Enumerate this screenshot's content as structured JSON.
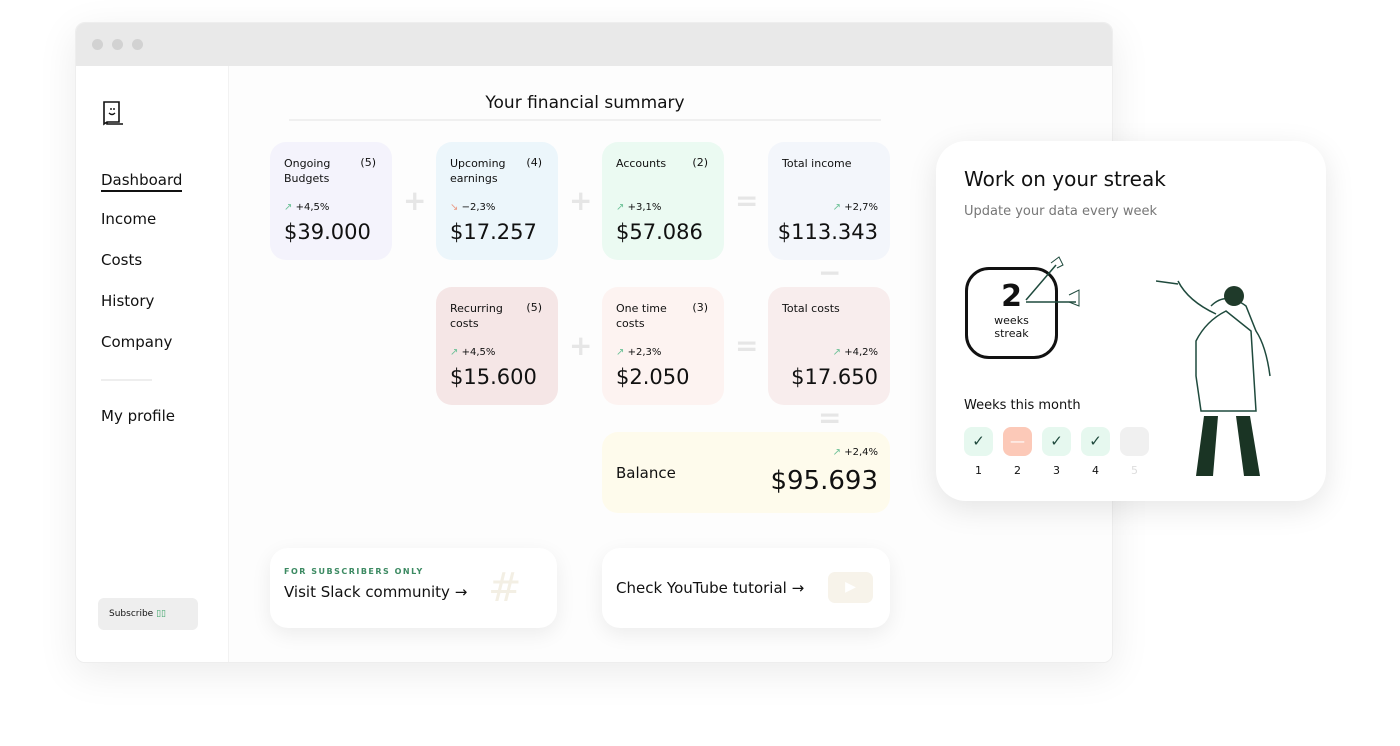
{
  "sidebar": {
    "items": [
      {
        "label": "Dashboard",
        "active": true
      },
      {
        "label": "Income"
      },
      {
        "label": "Costs"
      },
      {
        "label": "History"
      },
      {
        "label": "Company"
      }
    ],
    "profile": "My profile",
    "subscribe": "Subscribe"
  },
  "main": {
    "title": "Your financial summary",
    "cards": [
      {
        "title": "Ongoing Budgets",
        "count": "(5)",
        "change": "+4,5%",
        "trend": "up",
        "value": "$39.000",
        "color": "#f4f3fc"
      },
      {
        "title": "Upcoming earnings",
        "count": "(4)",
        "change": "−2,3%",
        "trend": "down",
        "value": "$17.257",
        "color": "#ecf6fb"
      },
      {
        "title": "Accounts",
        "count": "(2)",
        "change": "+3,1%",
        "trend": "up",
        "value": "$57.086",
        "color": "#ebfaf2"
      },
      {
        "title": "Total income",
        "count": "",
        "change": "+2,7%",
        "trend": "up",
        "value": "$113.343",
        "color": "#f3f6fb"
      },
      {
        "title": "Recurring costs",
        "count": "(5)",
        "change": "+4,5%",
        "trend": "up",
        "value": "$15.600",
        "color": "#f5e6e6"
      },
      {
        "title": "One time costs",
        "count": "(3)",
        "change": "+2,3%",
        "trend": "up",
        "value": "$2.050",
        "color": "#fdf3f1"
      },
      {
        "title": "Total costs",
        "count": "",
        "change": "+4,2%",
        "trend": "up",
        "value": "$17.650",
        "color": "#f8eded"
      }
    ],
    "balance": {
      "label": "Balance",
      "change": "+2,4%",
      "value": "$95.693"
    },
    "slack": {
      "kicker": "FOR SUBSCRIBERS ONLY",
      "label": "Visit Slack community",
      "arrow": "→"
    },
    "youtube": {
      "label": "Check YouTube tutorial",
      "arrow": "→"
    }
  },
  "streak": {
    "title": "Work on your streak",
    "subtitle": "Update your data every week",
    "count": "2",
    "unit": "weeks streak",
    "weeks_label": "Weeks this month",
    "weeks": [
      {
        "n": "1",
        "status": "done"
      },
      {
        "n": "2",
        "status": "missed"
      },
      {
        "n": "3",
        "status": "done"
      },
      {
        "n": "4",
        "status": "done"
      },
      {
        "n": "5",
        "status": "future"
      }
    ]
  }
}
